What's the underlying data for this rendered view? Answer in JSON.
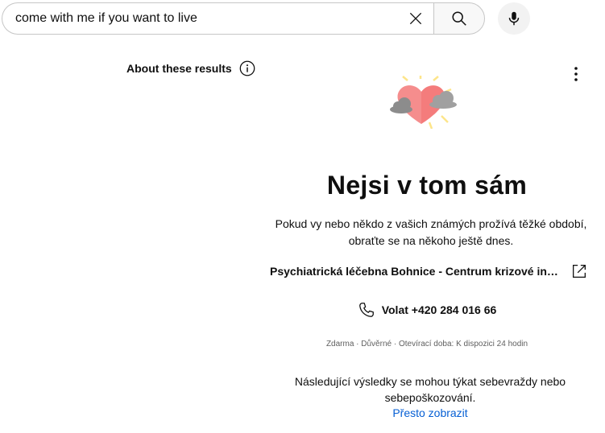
{
  "search": {
    "query": "come with me if you want to live",
    "clear_icon": "close-icon",
    "search_icon": "search-icon",
    "mic_icon": "microphone-icon"
  },
  "about": {
    "label": "About these results",
    "icon": "info-icon"
  },
  "more_icon": "more-vert-icon",
  "crisis_panel": {
    "illustration": "heart-with-clouds-illustration",
    "title": "Nejsi v tom sám",
    "subtitle": "Pokud vy nebo někdo z vašich známých prožívá těžké období, obraťte se na někoho ještě dnes.",
    "resource_name": "Psychiatrická léčebna Bohnice - Centrum krizové intervence",
    "resource_icon": "external-link-icon",
    "call_label": "Volat +420 284 016 66",
    "call_icon": "phone-icon",
    "meta": "Zdarma · Důvěrné · Otevírací doba: K dispozici 24 hodin",
    "warning": "Následující výsledky se mohou týkat sebevraždy nebo sebepoškozování.",
    "show_anyway": "Přesto zobrazit"
  },
  "colors": {
    "link": "#065fd4",
    "heart": "#f47c7c",
    "border": "#c6c6c6"
  }
}
